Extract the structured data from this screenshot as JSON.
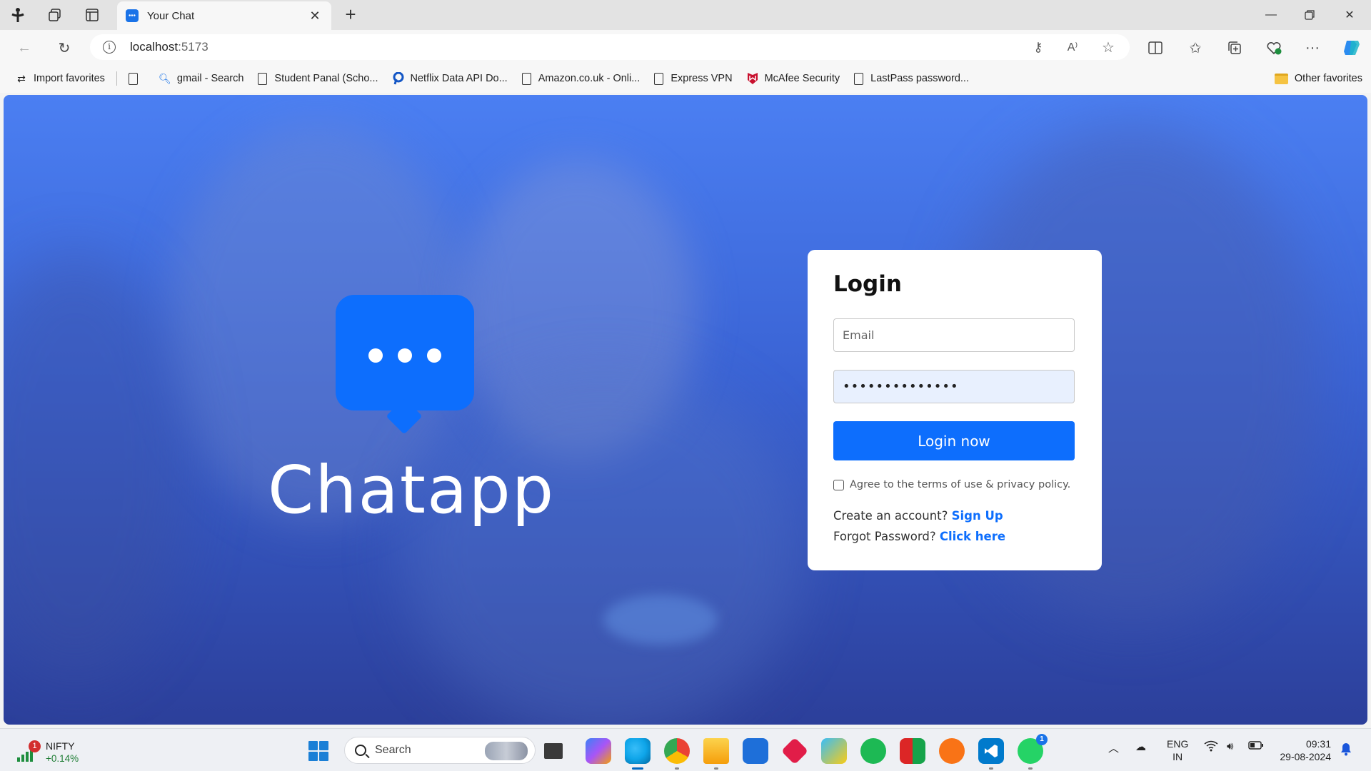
{
  "browser": {
    "tab": {
      "title": "Your Chat"
    },
    "address": {
      "host": "localhost",
      "port": ":5173"
    },
    "favorites": [
      {
        "label": "Import favorites",
        "icon": "import-icon"
      },
      {
        "label": "",
        "icon": "page-icon"
      },
      {
        "label": "gmail - Search",
        "icon": "search-icon"
      },
      {
        "label": "Student Panal (Scho...",
        "icon": "page-icon"
      },
      {
        "label": "Netflix Data API Do...",
        "icon": "rapidapi-icon"
      },
      {
        "label": "Amazon.co.uk - Onli...",
        "icon": "page-icon"
      },
      {
        "label": "Express VPN",
        "icon": "page-icon"
      },
      {
        "label": "McAfee Security",
        "icon": "mcafee-icon"
      },
      {
        "label": "LastPass password...",
        "icon": "page-icon"
      }
    ],
    "other_favorites": "Other favorites"
  },
  "page": {
    "brand": "Chatapp",
    "login": {
      "title": "Login",
      "email_placeholder": "Email",
      "email_value": "",
      "password_value": "••••••••••••••",
      "submit_label": "Login now",
      "terms_label": "Agree to the terms of use & privacy policy.",
      "create_prompt": "Create an account?",
      "signup_link": "Sign Up",
      "forgot_prompt": "Forgot Password?",
      "forgot_link": "Click here"
    },
    "colors": {
      "accent": "#0d6efd",
      "overlay": "#3a63d4"
    }
  },
  "taskbar": {
    "widget": {
      "badge": "1",
      "name": "NIFTY",
      "value": "+0.14%"
    },
    "search_label": "Search",
    "whatsapp_badge": "1",
    "lang_line1": "ENG",
    "lang_line2": "IN",
    "time": "09:31",
    "date": "29-08-2024"
  }
}
